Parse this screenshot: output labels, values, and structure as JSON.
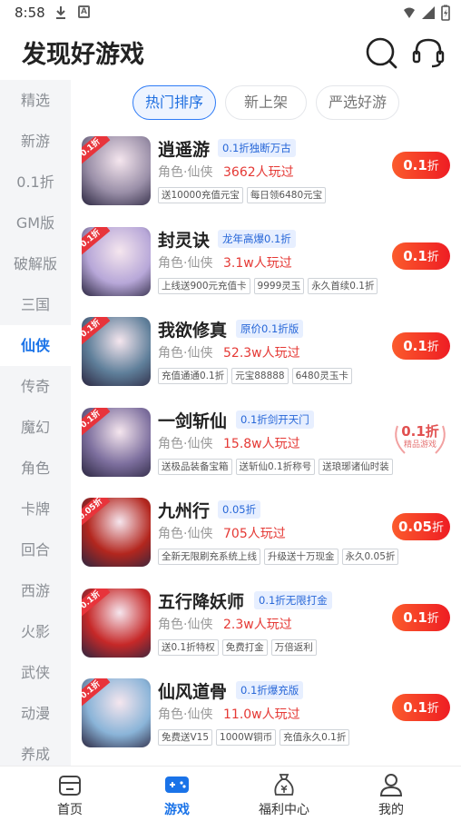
{
  "status_bar": {
    "time": "8:58"
  },
  "header": {
    "title": "发现好游戏",
    "search_icon": "search-icon",
    "service_icon": "headset-icon"
  },
  "sidebar": {
    "items": [
      "精选",
      "新游",
      "0.1折",
      "GM版",
      "破解版",
      "三国",
      "仙侠",
      "传奇",
      "魔幻",
      "角色",
      "卡牌",
      "回合",
      "西游",
      "火影",
      "武侠",
      "动漫",
      "养成"
    ],
    "active": "仙侠"
  },
  "tabs": [
    {
      "label": "热门排序",
      "active": true
    },
    {
      "label": "新上架",
      "active": false
    },
    {
      "label": "严选好游",
      "active": false
    }
  ],
  "games": [
    {
      "name": "逍遥游",
      "tag": "0.1折独断万古",
      "genre": "角色·仙侠",
      "players": "3662人玩过",
      "perks": [
        "送10000充值元宝",
        "每日领6480元宝"
      ],
      "discount": "0.1",
      "discount_unit": "折",
      "cover_label": "0.1折",
      "accent": "#9a8fa8"
    },
    {
      "name": "封灵诀",
      "tag": "龙年高爆0.1折",
      "genre": "角色·仙侠",
      "players": "3.1w人玩过",
      "perks": [
        "上线送900元充值卡",
        "9999灵玉",
        "永久首续0.1折"
      ],
      "discount": "0.1",
      "discount_unit": "折",
      "cover_label": "0.1折",
      "accent": "#b7a7d8"
    },
    {
      "name": "我欲修真",
      "tag": "原价0.1折版",
      "genre": "角色·仙侠",
      "players": "52.3w人玩过",
      "perks": [
        "充值通通0.1折",
        "元宝88888",
        "6480灵玉卡"
      ],
      "discount": "0.1",
      "discount_unit": "折",
      "cover_label": "0.1折",
      "accent": "#5f7f9a"
    },
    {
      "name": "一剑斩仙",
      "tag": "0.1折剑开天门",
      "genre": "角色·仙侠",
      "players": "15.8w人玩过",
      "perks": [
        "送极品装备宝箱",
        "送斩仙0.1折称号",
        "送琅琊诸仙时装"
      ],
      "discount": "0.1",
      "discount_unit": "折",
      "stamp_sub": "精品游戏",
      "cover_label": "0.1折",
      "accent": "#7d6f9e"
    },
    {
      "name": "九州行",
      "tag": "0.05折",
      "genre": "角色·仙侠",
      "players": "705人玩过",
      "perks": [
        "全新无限刷充系统上线",
        "升级送十万现金",
        "永久0.05折"
      ],
      "discount": "0.05",
      "discount_unit": "折",
      "cover_label": "0.05折",
      "accent": "#b3261e"
    },
    {
      "name": "五行降妖师",
      "tag": "0.1折无限打金",
      "genre": "角色·仙侠",
      "players": "2.3w人玩过",
      "perks": [
        "送0.1折特权",
        "免费打金",
        "万倍返利"
      ],
      "discount": "0.1",
      "discount_unit": "折",
      "cover_label": "0.1折",
      "accent": "#c62828"
    },
    {
      "name": "仙风道骨",
      "tag": "0.1折爆充版",
      "genre": "角色·仙侠",
      "players": "11.0w人玩过",
      "perks": [
        "免费送V15",
        "1000W铜币",
        "充值永久0.1折"
      ],
      "discount": "0.1",
      "discount_unit": "折",
      "cover_label": "0.1折",
      "accent": "#8ab4d8"
    }
  ],
  "bottom_nav": [
    {
      "label": "首页",
      "icon": "home-icon",
      "active": false
    },
    {
      "label": "游戏",
      "icon": "gamepad-icon",
      "active": true
    },
    {
      "label": "福利中心",
      "icon": "gift-bag-icon",
      "active": false
    },
    {
      "label": "我的",
      "icon": "user-icon",
      "active": false
    }
  ],
  "colors": {
    "accent_blue": "#1a73e8",
    "price_red": "#e53935",
    "discount_btn": "#ee1d23"
  }
}
